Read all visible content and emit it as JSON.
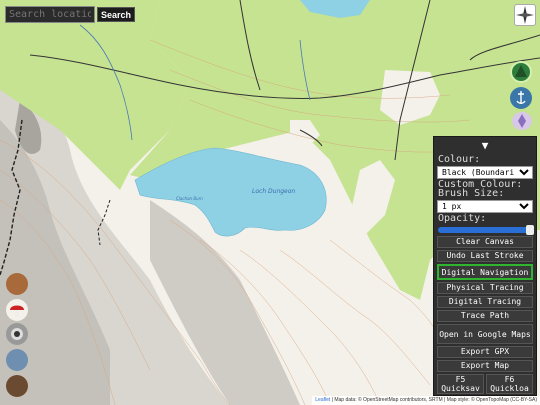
{
  "search": {
    "placeholder": "Search locatio",
    "button": "Search"
  },
  "map_labels": {
    "loch": "Loch Dungeon",
    "small_text": "Clachan Burn"
  },
  "panel": {
    "toggle": "▼",
    "colour_label": "Colour:",
    "colour_value": "Black (Boundari",
    "custom_colour_label": "Custom Colour:",
    "brush_label": "Brush Size:",
    "brush_value": "1 px",
    "opacity_label": "Opacity:",
    "opacity_value": 1.0,
    "buttons": {
      "clear": "Clear Canvas",
      "undo": "Undo Last Stroke",
      "digital_nav": "Digital Navigation",
      "physical": "Physical Tracing",
      "digital_tracing": "Digital Tracing",
      "trace_path": "Trace Path",
      "google": "Open in Google Maps",
      "gpx": "Export GPX",
      "export_map": "Export Map",
      "f5": "F5 Quicksav",
      "f6": "F6 Quickloa"
    }
  },
  "attribution": {
    "leaflet": "Leaflet",
    "text": "| Map data: © OpenStreetMap contributors, SRTM | Map style: © OpenTopoMap (CC-BY-SA)"
  },
  "colors": {
    "forest": "#c5e391",
    "water": "#8ed0e4",
    "panel": "#2f2f2f",
    "active": "#2fb52f"
  }
}
